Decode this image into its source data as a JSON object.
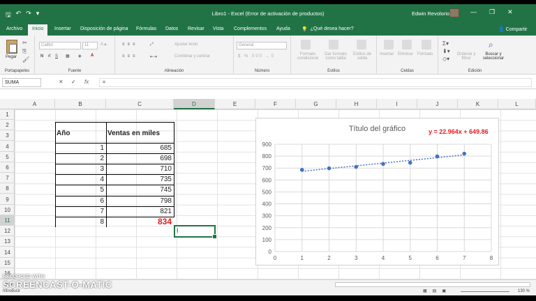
{
  "titlebar": {
    "title": "Libro1 - Excel (Error de activación de productos)",
    "user": "Edwin Revolorio",
    "minimize": "—",
    "restore": "❐",
    "close": "✕"
  },
  "tabs": [
    "Archivo",
    "Inicio",
    "Insertar",
    "Disposición de página",
    "Fórmulas",
    "Datos",
    "Revisar",
    "Vista",
    "Complementos",
    "Ayuda"
  ],
  "tab_active": "Inicio",
  "search_hint": "¿Qué desea hacer?",
  "share": "Compartir",
  "ribbon": {
    "paste": "Pegar",
    "clipboard": "Portapapeles",
    "font_name": "Calibri",
    "font_size": "11",
    "bold": "N",
    "italic": "K",
    "underline": "S",
    "font_group": "Fuente",
    "wrap_text": "Ajustar texto",
    "merge": "Combinar y centrar",
    "alignment_group": "Alineación",
    "number_format": "General",
    "number_group": "Número",
    "cond_format": "Formato condicional",
    "format_table": "Dar formato como tabla",
    "cell_styles": "Estilos de celda",
    "styles_group": "Estilos",
    "insert": "Insertar",
    "delete": "Eliminar",
    "format": "Formato",
    "cells_group": "Celdas",
    "sort": "Ordenar y filtrar",
    "find": "Buscar y seleccionar",
    "editing_group": "Edición"
  },
  "formula_bar": {
    "name_box": "SUMA",
    "cancel": "✕",
    "enter": "✓",
    "fx": "fx",
    "content": "="
  },
  "columns": [
    "A",
    "B",
    "C",
    "D",
    "E",
    "F",
    "G",
    "H",
    "I",
    "J",
    "K",
    "L"
  ],
  "selected_column": "D",
  "rows": [
    "1",
    "2",
    "3",
    "4",
    "5",
    "6",
    "7",
    "8",
    "9",
    "10",
    "11",
    "12",
    "13",
    "14",
    "15",
    "16"
  ],
  "selected_row": "11",
  "table": {
    "header_year": "Año",
    "header_sales": "Ventas en miles",
    "years": [
      "1",
      "2",
      "3",
      "4",
      "5",
      "6",
      "7",
      "8"
    ],
    "sales": [
      "685",
      "698",
      "710",
      "735",
      "745",
      "798",
      "821",
      "834"
    ],
    "highlight_color": "#e31c1c"
  },
  "chart_data": {
    "type": "scatter",
    "title": "Título del gráfico",
    "trendline_equation": "y = 22.964x + 649.86",
    "x": [
      1,
      2,
      3,
      4,
      5,
      6,
      7
    ],
    "y": [
      685,
      698,
      710,
      735,
      745,
      798,
      821
    ],
    "trendline": {
      "slope": 22.964,
      "intercept": 649.86
    },
    "xlim": [
      0,
      8
    ],
    "ylim": [
      0,
      900
    ],
    "x_ticks": [
      "0",
      "1",
      "2",
      "3",
      "4",
      "5",
      "6",
      "7",
      "8"
    ],
    "y_ticks": [
      "0",
      "100",
      "200",
      "300",
      "400",
      "500",
      "600",
      "700",
      "800",
      "900"
    ],
    "grid": true,
    "marker_color": "#4472c4"
  },
  "status": {
    "mode": "Introducir",
    "zoom": "130 %"
  },
  "watermark": {
    "line1": "RECORDED WITH",
    "line2": "SCREENCAST-O-MATIC"
  }
}
